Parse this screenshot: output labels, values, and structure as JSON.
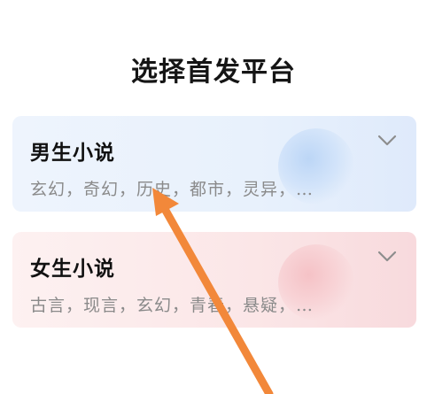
{
  "page": {
    "title": "选择首发平台"
  },
  "cards": [
    {
      "title": "男生小说",
      "tags": "玄幻，奇幻，历史，都市，灵异，…",
      "accent": "#dfeafb",
      "icon": "chevron-down-icon"
    },
    {
      "title": "女生小说",
      "tags": "古言，现言，玄幻，青春，悬疑，…",
      "accent": "#f8dadd",
      "icon": "chevron-down-icon"
    }
  ],
  "annotation": {
    "arrow_color": "#f2883a",
    "icon": "arrow-pointer-icon"
  }
}
